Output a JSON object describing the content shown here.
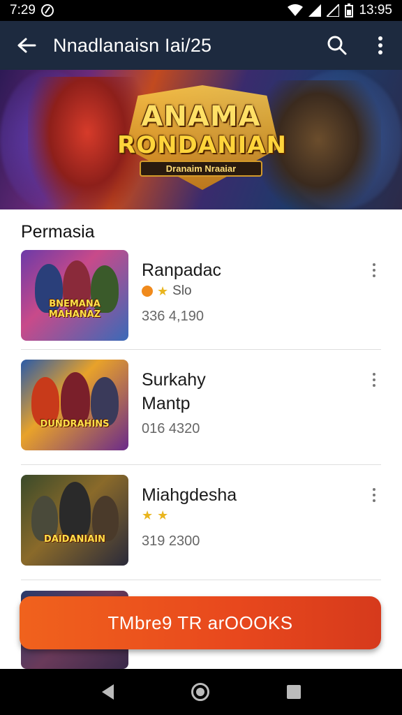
{
  "status_bar": {
    "time": "7:29",
    "clock_right": "13:95"
  },
  "app_bar": {
    "title": "Nnadlanaisn Iai/25"
  },
  "banner": {
    "title_line1": "ANAMA",
    "title_line2": "RONDANIAN",
    "subtitle": "Dranaim Nraaiar"
  },
  "section": {
    "title": "Permasia"
  },
  "items": [
    {
      "title": "Ranpadac",
      "meta": "Slo",
      "count": "336 4,190",
      "thumb_label": "BNEMANA MAHANAZ"
    },
    {
      "title": "Surkahy\nMantp",
      "meta": "",
      "count": "016 4320",
      "thumb_label": "DUNDRAHINS"
    },
    {
      "title": "Miahgdesha",
      "meta": "",
      "count": "319 2300",
      "thumb_label": "DAIDANIAIN"
    }
  ],
  "cta": {
    "label": "TMbre9 TR arOOOKS"
  },
  "colors": {
    "app_bar": "#1d2a3f",
    "cta": "#e8481d",
    "accent_star": "#e9b51e"
  }
}
